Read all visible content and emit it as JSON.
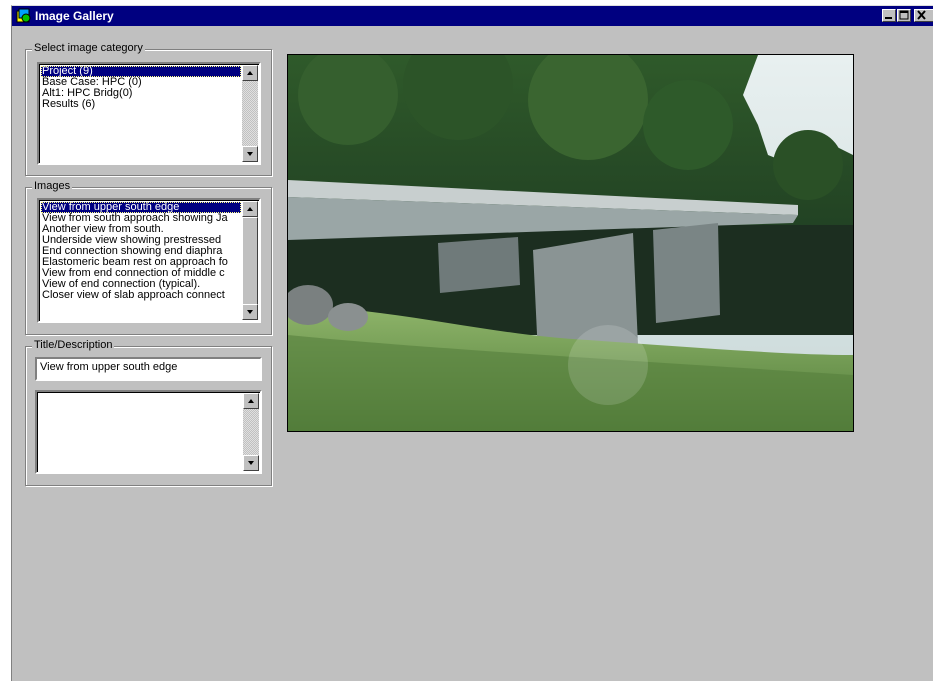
{
  "window": {
    "title": "Image Gallery",
    "controls": {
      "minimize": "minimize-icon",
      "maximize": "maximize-icon",
      "close": "close-icon"
    }
  },
  "category_group": {
    "label": "Select image category",
    "items": [
      {
        "label": "Project (9)",
        "selected": true
      },
      {
        "label": "Base Case: HPC (0)",
        "selected": false
      },
      {
        "label": "Alt1: HPC Bridg(0)",
        "selected": false
      },
      {
        "label": "Results (6)",
        "selected": false
      }
    ]
  },
  "images_group": {
    "label": "Images",
    "items": [
      {
        "label": "View from upper south edge",
        "selected": true
      },
      {
        "label": "View from south approach showing Ja",
        "selected": false
      },
      {
        "label": "Another view from south.",
        "selected": false
      },
      {
        "label": "Underside view showing prestressed",
        "selected": false
      },
      {
        "label": "End connection showing end diaphra",
        "selected": false
      },
      {
        "label": "Elastomeric beam rest on approach fo",
        "selected": false
      },
      {
        "label": "View from end connection of middle c",
        "selected": false
      },
      {
        "label": "View of end connection (typical).",
        "selected": false
      },
      {
        "label": "Closer view of slab approach connect",
        "selected": false
      }
    ]
  },
  "description_group": {
    "label": "Title/Description",
    "title_value": "View from upper south edge",
    "description_value": ""
  },
  "photo": {
    "subject": "bridge-photo"
  },
  "colors": {
    "titlebar": "#000080",
    "window_bg": "#c0c0c0",
    "selection": "#000080"
  }
}
